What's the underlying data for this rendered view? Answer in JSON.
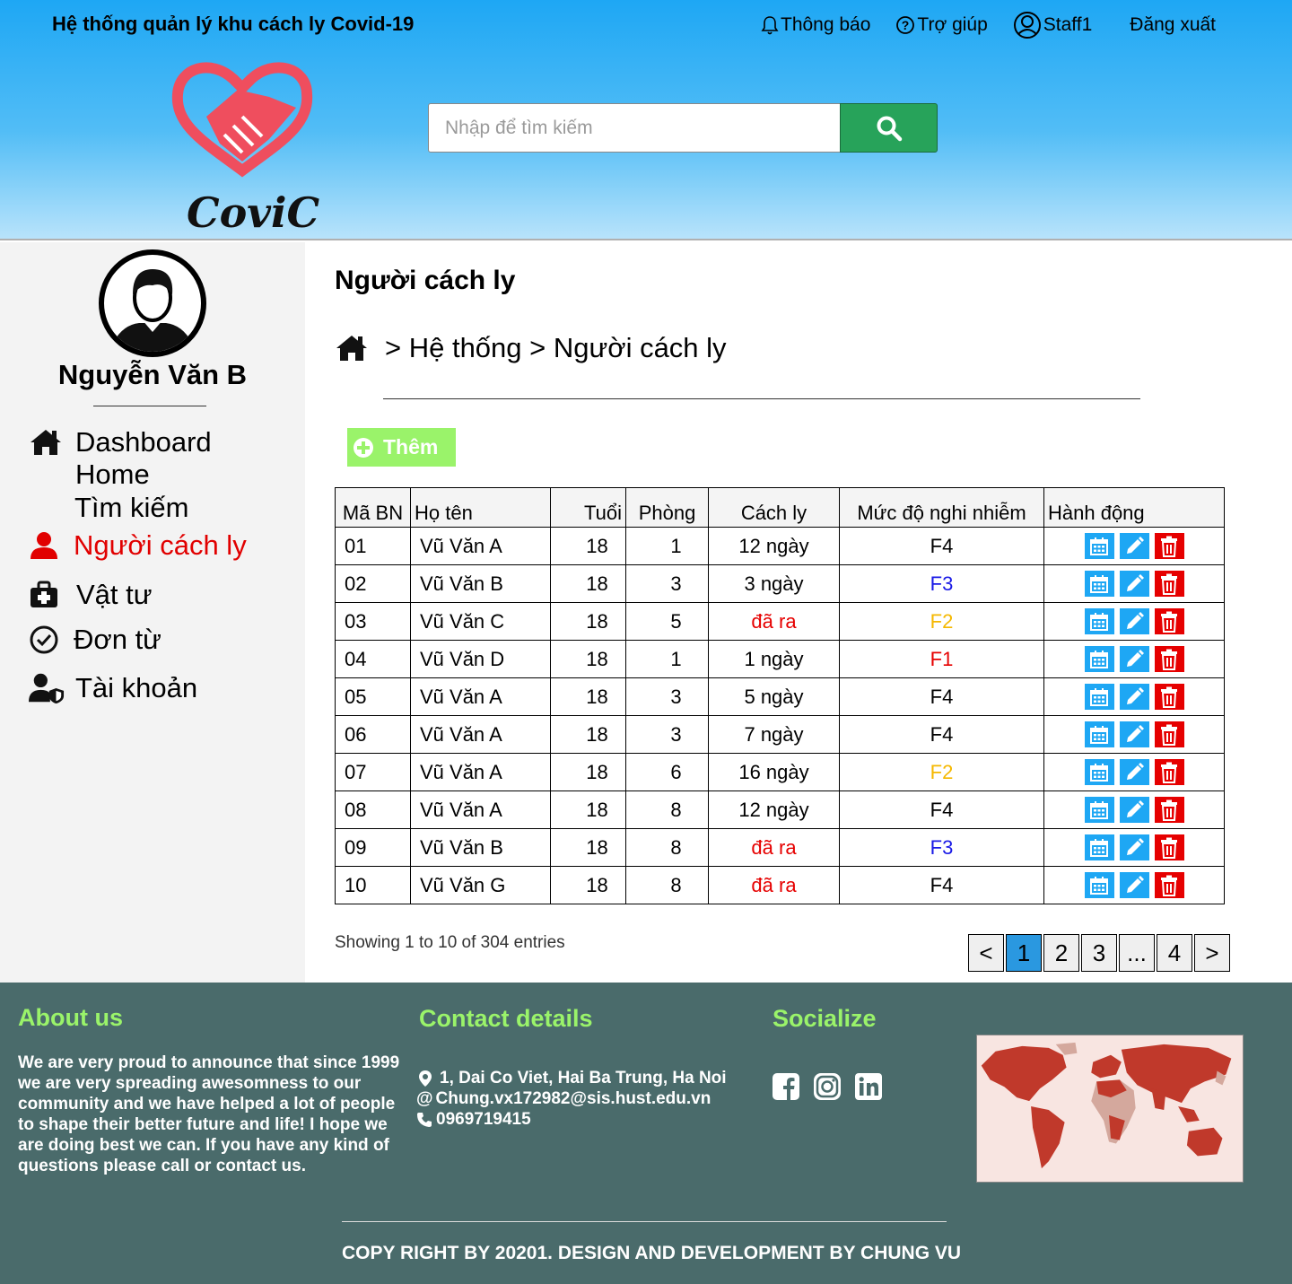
{
  "header": {
    "app_title": "Hệ thống quản lý khu cách  ly Covid-19",
    "nav": {
      "notifications": "Thông báo",
      "help": "Trợ giúp",
      "user": "Staff1",
      "logout": "Đăng xuất"
    },
    "logo_text": "CoviC",
    "search_placeholder": "Nhập để tìm kiếm"
  },
  "sidebar": {
    "user_name": "Nguyễn Văn B",
    "menu": {
      "dashboard": "Dashboard",
      "home": "Home",
      "search": "Tìm kiếm",
      "quarantined": "Người cách ly",
      "supplies": "Vật tư",
      "forms": "Đơn từ",
      "account": "Tài khoản"
    },
    "active_color": "#e10000"
  },
  "main": {
    "page_title": "Người cách ly",
    "breadcrumb": "> Hệ thống > Người cách ly",
    "add_label": "Thêm",
    "columns": [
      "Mã BN",
      "Họ tên",
      "Tuổi",
      "Phòng",
      "Cách ly",
      "Mức độ nghi nhiễm",
      "Hành động"
    ],
    "rows": [
      {
        "id": "01",
        "name": "Vũ Văn A",
        "age": "18",
        "room": "1",
        "quarantine": "12 ngày",
        "qcolor": "#000",
        "level": "F4",
        "lcolor": "#000"
      },
      {
        "id": "02",
        "name": "Vũ Văn B",
        "age": "18",
        "room": "3",
        "quarantine": "3 ngày",
        "qcolor": "#000",
        "level": "F3",
        "lcolor": "#1a1ae6"
      },
      {
        "id": "03",
        "name": "Vũ Văn C",
        "age": "18",
        "room": "5",
        "quarantine": "đã ra",
        "qcolor": "#e60000",
        "level": "F2",
        "lcolor": "#f5b800"
      },
      {
        "id": "04",
        "name": "Vũ Văn D",
        "age": "18",
        "room": "1",
        "quarantine": "1 ngày",
        "qcolor": "#000",
        "level": "F1",
        "lcolor": "#e60000"
      },
      {
        "id": "05",
        "name": "Vũ Văn A",
        "age": "18",
        "room": "3",
        "quarantine": "5 ngày",
        "qcolor": "#000",
        "level": "F4",
        "lcolor": "#000"
      },
      {
        "id": "06",
        "name": "Vũ Văn A",
        "age": "18",
        "room": "3",
        "quarantine": "7 ngày",
        "qcolor": "#000",
        "level": "F4",
        "lcolor": "#000"
      },
      {
        "id": "07",
        "name": "Vũ Văn A",
        "age": "18",
        "room": "6",
        "quarantine": "16 ngày",
        "qcolor": "#000",
        "level": "F2",
        "lcolor": "#f5b800"
      },
      {
        "id": "08",
        "name": "Vũ Văn A",
        "age": "18",
        "room": "8",
        "quarantine": "12 ngày",
        "qcolor": "#000",
        "level": "F4",
        "lcolor": "#000"
      },
      {
        "id": "09",
        "name": "Vũ Văn B",
        "age": "18",
        "room": "8",
        "quarantine": "đã ra",
        "qcolor": "#e60000",
        "level": "F3",
        "lcolor": "#1a1ae6"
      },
      {
        "id": "10",
        "name": "Vũ Văn G",
        "age": "18",
        "room": "8",
        "quarantine": "đã ra",
        "qcolor": "#e60000",
        "level": "F4",
        "lcolor": "#000"
      }
    ],
    "showing": "Showing 1 to 10 of 304 entries",
    "pagination": [
      "<",
      "1",
      "2",
      "3",
      "...",
      "4",
      ">"
    ],
    "active_page": "1"
  },
  "footer": {
    "about_title": "About us",
    "about_text": "We are very proud to announce that since 1999 we are very spreading awesomness to our community and we have helped a lot of people to shape their better future and life! I hope we are doing best we can. If you have any kind of questions please call or contact us.",
    "contact_title": "Contact details",
    "address": "1, Dai Co Viet, Hai Ba Trung, Ha Noi",
    "email": "Chung.vx172982@sis.hust.edu.vn",
    "phone": "0969719415",
    "social_title": "Socialize",
    "social_icons": [
      "facebook-icon",
      "instagram-icon",
      "linkedin-icon"
    ],
    "copyright": "COPY RIGHT BY 20201. DESIGN AND DEVELOPMENT BY CHUNG VU"
  }
}
